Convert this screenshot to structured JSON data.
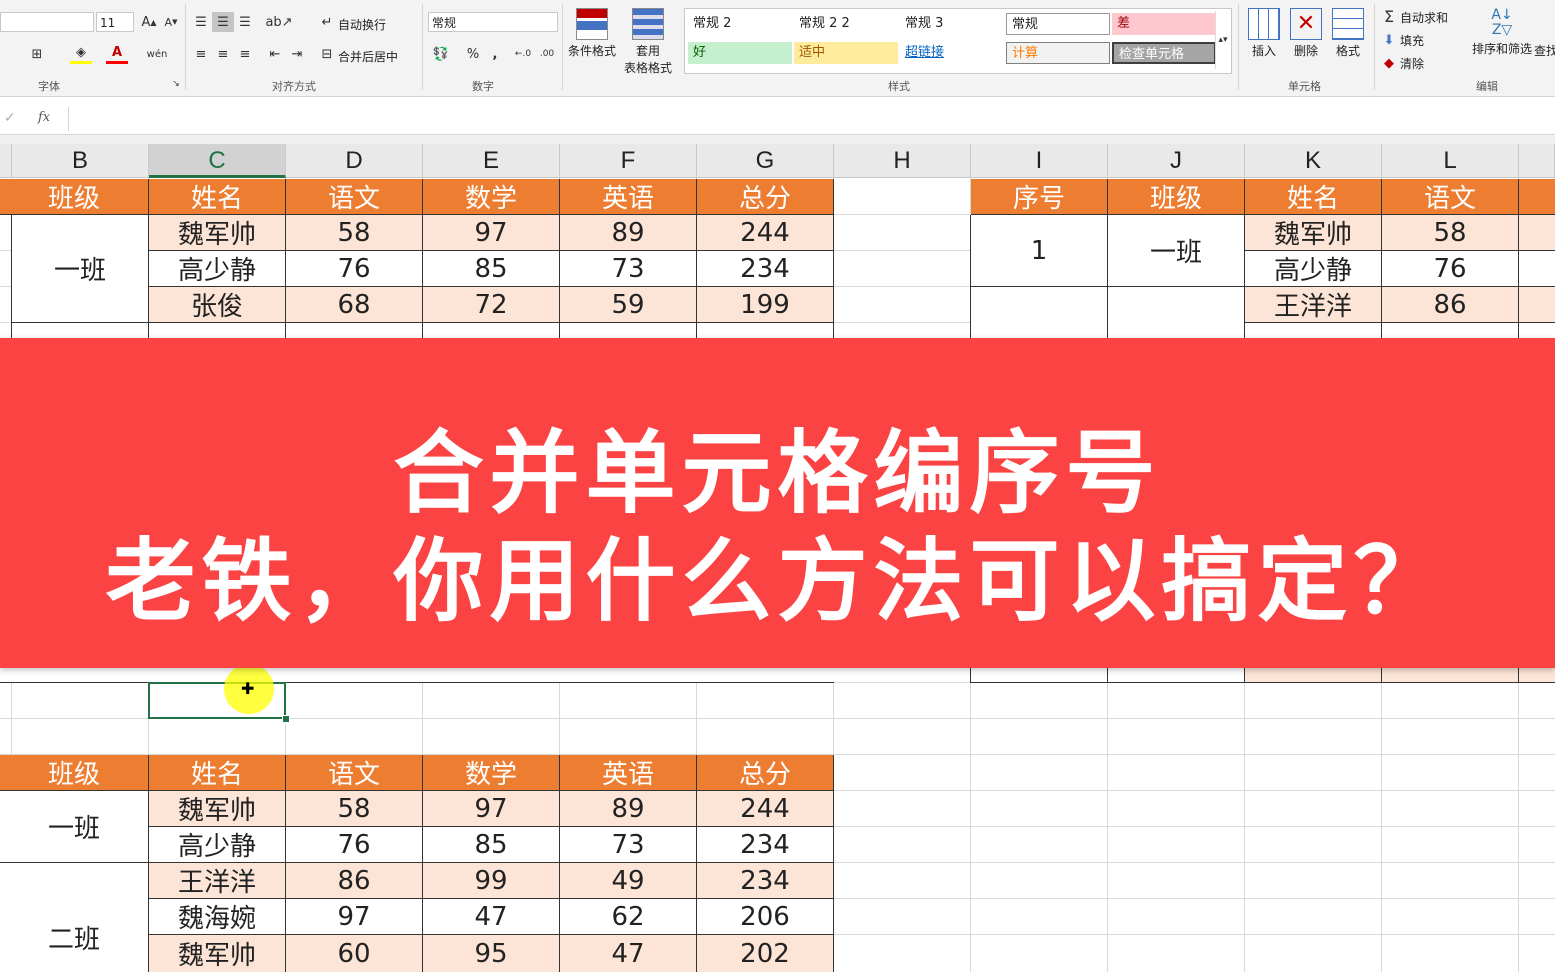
{
  "ribbon": {
    "font_size": "11",
    "font_group": "字体",
    "align_group": "对齐方式",
    "wrap_text": "自动换行",
    "merge_center": "合并后居中",
    "number_group": "数字",
    "number_format": "常规",
    "percent": "%",
    "comma": ",",
    "inc_decimal": "←.0",
    "dec_decimal": ".00",
    "cond_format": "条件格式",
    "table_format_1": "套用",
    "table_format_2": "表格格式",
    "styles_group": "样式",
    "styles": [
      {
        "label": "常规 2",
        "bg": "#ffffff",
        "color": "#222222"
      },
      {
        "label": "常规 2 2",
        "bg": "#ffffff",
        "color": "#222222"
      },
      {
        "label": "常规 3",
        "bg": "#ffffff",
        "color": "#222222"
      },
      {
        "label": "常规",
        "bg": "#ffffff",
        "color": "#222222"
      },
      {
        "label": "差",
        "bg": "#ffc7ce",
        "color": "#9c0006"
      },
      {
        "label": "好",
        "bg": "#c6efce",
        "color": "#006100"
      },
      {
        "label": "适中",
        "bg": "#ffeb9c",
        "color": "#9c5700"
      },
      {
        "label": "超链接",
        "bg": "#ffffff",
        "color": "#0563c1"
      },
      {
        "label": "计算",
        "bg": "#f2f2f2",
        "color": "#fa7d00"
      },
      {
        "label": "检查单元格",
        "bg": "#a5a5a5",
        "color": "#ffffff"
      }
    ],
    "insert": "插入",
    "delete": "删除",
    "format": "格式",
    "cells_group": "单元格",
    "autosum": "自动求和",
    "fill": "填充",
    "clear": "清除",
    "sort_filter": "排序和筛选",
    "find": "查找",
    "edit_group": "编辑"
  },
  "formula_bar": {
    "fx": "fx",
    "check": "✓"
  },
  "columns": [
    "B",
    "C",
    "D",
    "E",
    "F",
    "G",
    "H",
    "I",
    "J",
    "K",
    "L"
  ],
  "selected_column": "C",
  "table_top": {
    "headers": [
      "班级",
      "姓名",
      "语文",
      "数学",
      "英语",
      "总分"
    ],
    "class": "一班",
    "rows": [
      [
        "魏军帅",
        "58",
        "97",
        "89",
        "244"
      ],
      [
        "高少静",
        "76",
        "85",
        "73",
        "234"
      ],
      [
        "张俊",
        "68",
        "72",
        "59",
        "199"
      ]
    ]
  },
  "table_right": {
    "headers": [
      "序号",
      "班级",
      "姓名",
      "语文"
    ],
    "seq": "1",
    "class": "一班",
    "rows": [
      [
        "魏军帅",
        "58"
      ],
      [
        "高少静",
        "76"
      ],
      [
        "王洋洋",
        "86"
      ]
    ]
  },
  "table_bottom": {
    "headers": [
      "班级",
      "姓名",
      "语文",
      "数学",
      "英语",
      "总分"
    ],
    "class1": "一班",
    "class2": "二班",
    "rows": [
      [
        "魏军帅",
        "58",
        "97",
        "89",
        "244"
      ],
      [
        "高少静",
        "76",
        "85",
        "73",
        "234"
      ],
      [
        "王洋洋",
        "86",
        "99",
        "49",
        "234"
      ],
      [
        "魏海婉",
        "97",
        "47",
        "62",
        "206"
      ],
      [
        "魏军帅",
        "60",
        "95",
        "47",
        "202"
      ]
    ]
  },
  "banner": {
    "line1": "合并单元格编序号",
    "line2": "老铁，你用什么方法可以搞定？"
  },
  "colors": {
    "header_orange": "#ed7d31",
    "row_pink": "#fce4d6",
    "banner_red": "#fb4343"
  }
}
